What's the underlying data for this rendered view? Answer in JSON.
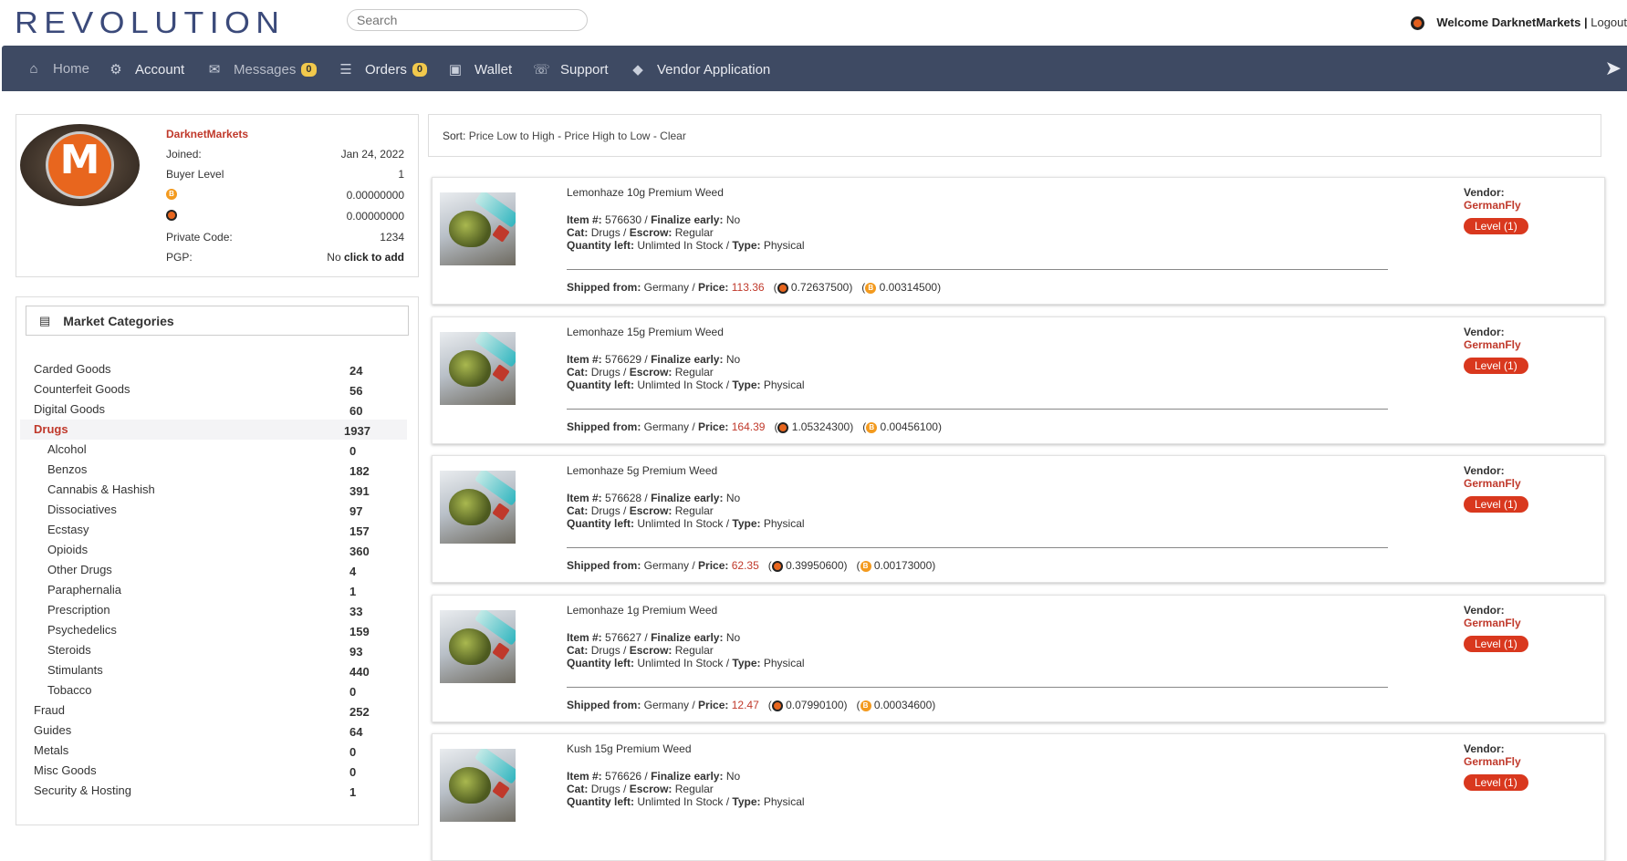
{
  "header": {
    "logo_text": "REVOLUTION",
    "search_placeholder": "Search",
    "welcome_prefix": "Welcome",
    "username": "DarknetMarkets",
    "separator": "|",
    "logout_label": "Logout"
  },
  "nav": {
    "items": [
      {
        "label": "Home",
        "icon": "home-icon"
      },
      {
        "label": "Account",
        "icon": "gears-icon"
      },
      {
        "label": "Messages",
        "icon": "envelope-icon",
        "badge": "0"
      },
      {
        "label": "Orders",
        "icon": "list-icon",
        "badge": "0"
      },
      {
        "label": "Wallet",
        "icon": "wallet-icon"
      },
      {
        "label": "Support",
        "icon": "support-icon"
      },
      {
        "label": "Vendor Application",
        "icon": "shield-icon"
      }
    ],
    "right_icon": "rocket-icon"
  },
  "profile": {
    "username": "DarknetMarkets",
    "joined_label": "Joined:",
    "joined_value": "Jan 24, 2022",
    "buyer_level_label": "Buyer Level",
    "buyer_level_value": "1",
    "btc_balance": "0.00000000",
    "xmr_balance": "0.00000000",
    "private_code_label": "Private Code:",
    "private_code_value": "1234",
    "pgp_label": "PGP:",
    "pgp_value": "No",
    "pgp_action": "click to add"
  },
  "categories": {
    "title": "Market Categories",
    "items": [
      {
        "name": "Carded Goods",
        "count": "24",
        "level": "top"
      },
      {
        "name": "Counterfeit Goods",
        "count": "56",
        "level": "top"
      },
      {
        "name": "Digital Goods",
        "count": "60",
        "level": "top"
      },
      {
        "name": "Drugs",
        "count": "1937",
        "level": "top",
        "active": true
      },
      {
        "name": "Alcohol",
        "count": "0",
        "level": "sub"
      },
      {
        "name": "Benzos",
        "count": "182",
        "level": "sub"
      },
      {
        "name": "Cannabis & Hashish",
        "count": "391",
        "level": "sub"
      },
      {
        "name": "Dissociatives",
        "count": "97",
        "level": "sub"
      },
      {
        "name": "Ecstasy",
        "count": "157",
        "level": "sub"
      },
      {
        "name": "Opioids",
        "count": "360",
        "level": "sub"
      },
      {
        "name": "Other Drugs",
        "count": "4",
        "level": "sub"
      },
      {
        "name": "Paraphernalia",
        "count": "1",
        "level": "sub"
      },
      {
        "name": "Prescription",
        "count": "33",
        "level": "sub"
      },
      {
        "name": "Psychedelics",
        "count": "159",
        "level": "sub"
      },
      {
        "name": "Steroids",
        "count": "93",
        "level": "sub"
      },
      {
        "name": "Stimulants",
        "count": "440",
        "level": "sub"
      },
      {
        "name": "Tobacco",
        "count": "0",
        "level": "sub"
      },
      {
        "name": "Fraud",
        "count": "252",
        "level": "top"
      },
      {
        "name": "Guides",
        "count": "64",
        "level": "top"
      },
      {
        "name": "Metals",
        "count": "0",
        "level": "top"
      },
      {
        "name": "Misc Goods",
        "count": "0",
        "level": "top"
      },
      {
        "name": "Security & Hosting",
        "count": "1",
        "level": "top"
      }
    ]
  },
  "sort": {
    "label": "Sort:",
    "low_high": "Price Low to High",
    "dash1": "-",
    "high_low": "Price High to Low",
    "dash2": "-",
    "clear": "Clear"
  },
  "listing_labels": {
    "item": "Item #:",
    "finalize": "Finalize early:",
    "cat": "Cat:",
    "escrow": "Escrow:",
    "qty": "Quantity left:",
    "type": "Type:",
    "shipped": "Shipped from:",
    "price": "Price:",
    "vendor": "Vendor:"
  },
  "listings": [
    {
      "title": "Lemonhaze 10g Premium Weed",
      "item_no": "576630",
      "finalize": "No",
      "cat": "Drugs",
      "escrow": "Regular",
      "qty": "Unlimted In Stock",
      "type": "Physical",
      "ship_from": "Germany",
      "price": "113.36",
      "xmr": "0.72637500",
      "btc": "0.00314500",
      "vendor": "GermanFly",
      "level": "Level (1)"
    },
    {
      "title": "Lemonhaze 15g Premium Weed",
      "item_no": "576629",
      "finalize": "No",
      "cat": "Drugs",
      "escrow": "Regular",
      "qty": "Unlimted In Stock",
      "type": "Physical",
      "ship_from": "Germany",
      "price": "164.39",
      "xmr": "1.05324300",
      "btc": "0.00456100",
      "vendor": "GermanFly",
      "level": "Level (1)"
    },
    {
      "title": "Lemonhaze 5g Premium Weed",
      "item_no": "576628",
      "finalize": "No",
      "cat": "Drugs",
      "escrow": "Regular",
      "qty": "Unlimted In Stock",
      "type": "Physical",
      "ship_from": "Germany",
      "price": "62.35",
      "xmr": "0.39950600",
      "btc": "0.00173000",
      "vendor": "GermanFly",
      "level": "Level (1)"
    },
    {
      "title": "Lemonhaze 1g Premium Weed",
      "item_no": "576627",
      "finalize": "No",
      "cat": "Drugs",
      "escrow": "Regular",
      "qty": "Unlimted In Stock",
      "type": "Physical",
      "ship_from": "Germany",
      "price": "12.47",
      "xmr": "0.07990100",
      "btc": "0.00034600",
      "vendor": "GermanFly",
      "level": "Level (1)"
    },
    {
      "title": "Kush 15g Premium Weed",
      "item_no": "576626",
      "finalize": "No",
      "cat": "Drugs",
      "escrow": "Regular",
      "qty": "Unlimted In Stock",
      "type": "Physical",
      "vendor": "GermanFly",
      "level": "Level (1)"
    }
  ]
}
